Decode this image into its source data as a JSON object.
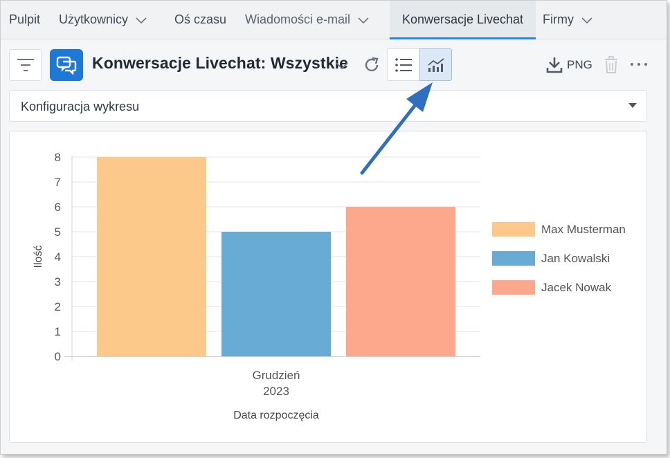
{
  "nav": {
    "tabs": [
      {
        "label": "Pulpit",
        "dropdown": false,
        "active": false
      },
      {
        "label": "Użytkownicy",
        "dropdown": true,
        "active": false
      },
      {
        "label": "Oś czasu",
        "dropdown": false,
        "active": false
      },
      {
        "label": "Wiadomości e-mail",
        "dropdown": true,
        "active": false
      },
      {
        "label": "Konwersacje Livechat",
        "dropdown": false,
        "active": true
      },
      {
        "label": "Firmy",
        "dropdown": true,
        "active": false
      }
    ]
  },
  "toolbar": {
    "title": "Konwersacje Livechat: Wszystkie",
    "export_label": "PNG",
    "view_mode": "chart"
  },
  "config": {
    "label": "Konfiguracja wykresu"
  },
  "colors": {
    "accent": "#1e78d6",
    "arrow": "#2f6fbf"
  },
  "chart_data": {
    "type": "bar",
    "categories": [
      "Grudzień 2023"
    ],
    "category_lines": [
      "Grudzień",
      "2023"
    ],
    "series": [
      {
        "name": "Max Musterman",
        "values": [
          8
        ],
        "color": "#fdc98a"
      },
      {
        "name": "Jan Kowalski",
        "values": [
          5
        ],
        "color": "#68abd4"
      },
      {
        "name": "Jacek Nowak",
        "values": [
          6
        ],
        "color": "#fda88c"
      }
    ],
    "xlabel": "Data rozpoczęcia",
    "ylabel": "Ilość",
    "ylim": [
      0,
      8
    ],
    "yticks": [
      0,
      1,
      2,
      3,
      4,
      5,
      6,
      7,
      8
    ],
    "grid": true,
    "legend": "right"
  }
}
